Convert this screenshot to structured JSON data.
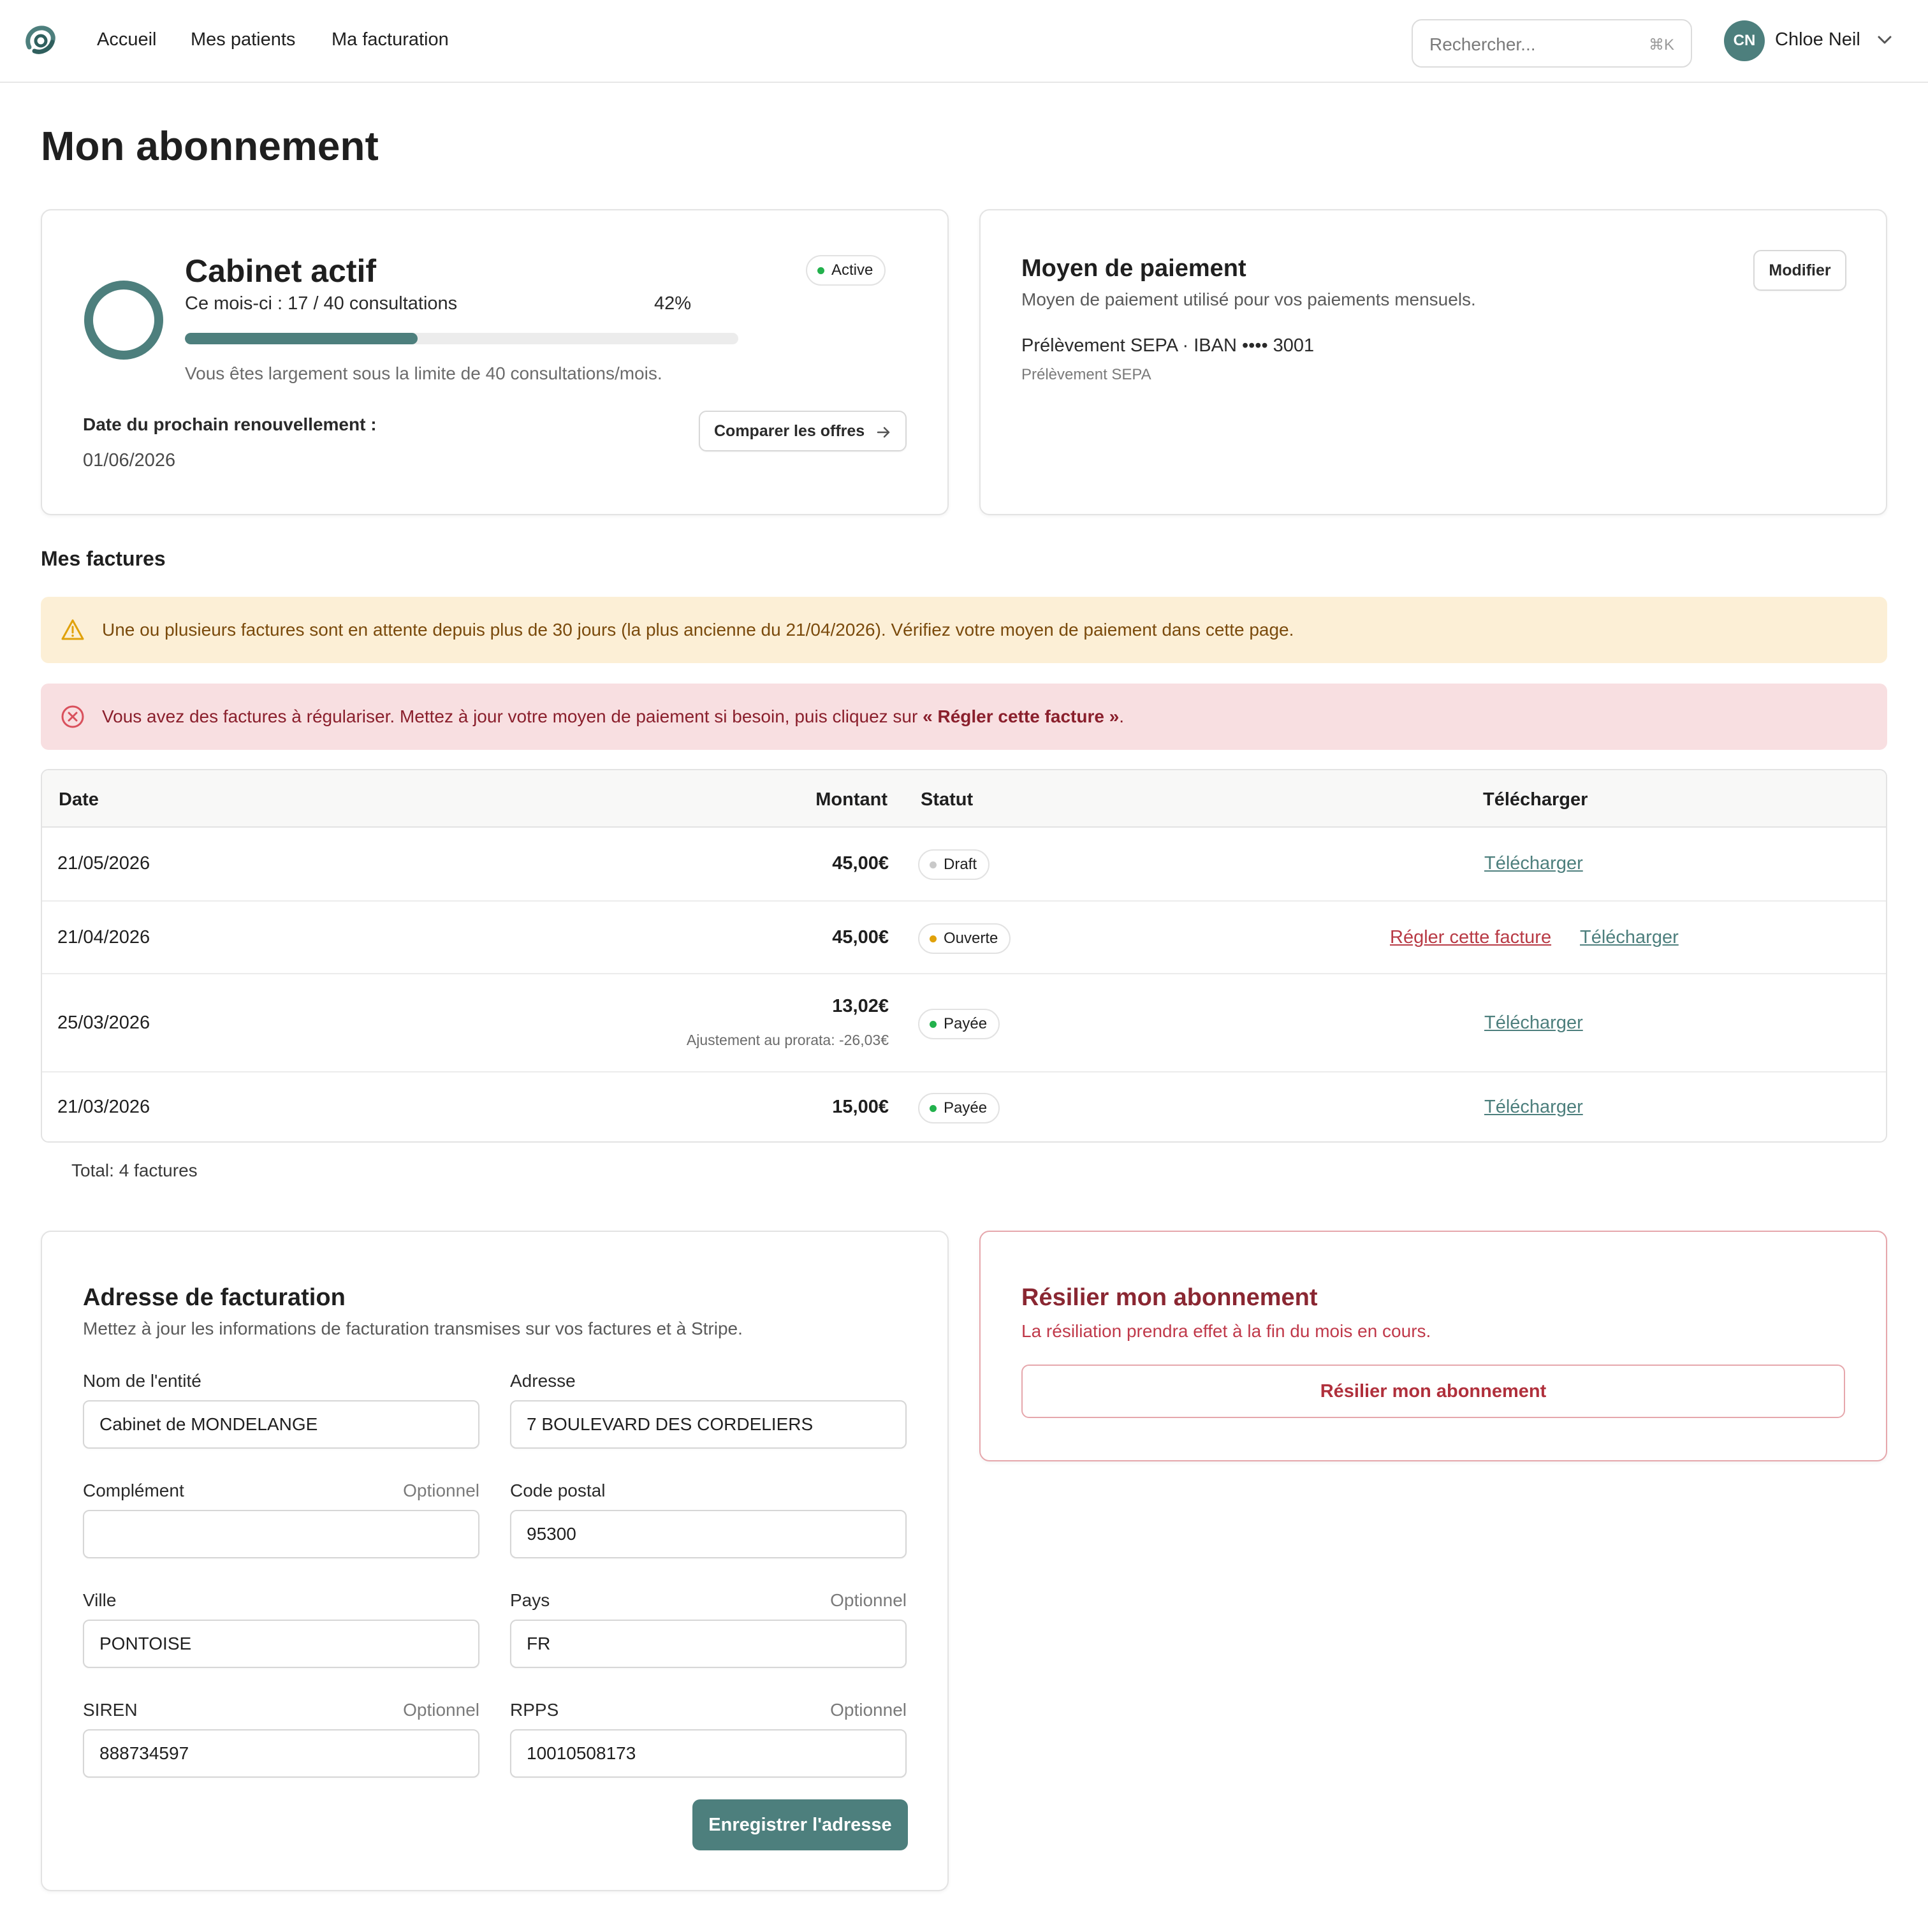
{
  "header": {
    "nav": [
      "Accueil",
      "Mes patients",
      "Ma facturation"
    ],
    "search": {
      "placeholder": "Rechercher...",
      "shortcut": "⌘K"
    },
    "user": {
      "initials": "CN",
      "name": "Chloe Neil"
    }
  },
  "page": {
    "title": "Mon abonnement"
  },
  "subscription": {
    "plan": "Cabinet actif",
    "status": "Active",
    "usage_text": "Ce mois-ci : 17 / 40 consultations",
    "usage_percent_label": "42%",
    "usage_fraction": 0.42,
    "usage_note": "Vous êtes largement sous la limite de 40 consultations/mois.",
    "renewal_label": "Date du prochain renouvellement :",
    "renewal_date": "01/06/2026",
    "compare_button": "Comparer les offres"
  },
  "payment": {
    "title": "Moyen de paiement",
    "subtitle": "Moyen de paiement utilisé pour vos paiements mensuels.",
    "method": "Prélèvement SEPA · IBAN •••• 3001",
    "method_type": "Prélèvement SEPA",
    "edit_button": "Modifier"
  },
  "invoices": {
    "title": "Mes factures",
    "warning": "Une ou plusieurs factures sont en attente depuis plus de 30 jours (la plus ancienne du 21/04/2026). Vérifiez votre moyen de paiement dans cette page.",
    "error_prefix": "Vous avez des factures à régulariser. Mettez à jour votre moyen de paiement si besoin, puis cliquez sur ",
    "error_emphasis": "« Régler cette facture »",
    "error_suffix": ".",
    "columns": {
      "date": "Date",
      "amount": "Montant",
      "status": "Statut",
      "download": "Télécharger"
    },
    "rows": [
      {
        "date": "21/05/2026",
        "amount": "45,00€",
        "status": "Draft",
        "download": "Télécharger"
      },
      {
        "date": "21/04/2026",
        "amount": "45,00€",
        "status": "Ouverte",
        "pay": "Régler cette facture",
        "download": "Télécharger"
      },
      {
        "date": "25/03/2026",
        "amount": "13,02€",
        "note": "Ajustement au prorata: -26,03€",
        "status": "Payée",
        "download": "Télécharger"
      },
      {
        "date": "21/03/2026",
        "amount": "15,00€",
        "status": "Payée",
        "download": "Télécharger"
      }
    ],
    "total": "Total: 4 factures"
  },
  "address": {
    "title": "Adresse de facturation",
    "subtitle": "Mettez à jour les informations de facturation transmises sur vos factures et à Stripe.",
    "optional_label": "Optionnel",
    "fields": {
      "entity": {
        "label": "Nom de l'entité",
        "value": "Cabinet de MONDELANGE"
      },
      "address": {
        "label": "Adresse",
        "value": "7 BOULEVARD DES CORDELIERS"
      },
      "complement": {
        "label": "Complément",
        "value": ""
      },
      "postal": {
        "label": "Code postal",
        "value": "95300"
      },
      "city": {
        "label": "Ville",
        "value": "PONTOISE"
      },
      "country": {
        "label": "Pays",
        "value": "FR"
      },
      "siren": {
        "label": "SIREN",
        "value": "888734597"
      },
      "rpps": {
        "label": "RPPS",
        "value": "10010508173"
      }
    },
    "save_button": "Enregistrer l'adresse"
  },
  "cancel": {
    "title": "Résilier mon abonnement",
    "subtitle": "La résiliation prendra effet à la fin du mois en cours.",
    "button": "Résilier mon abonnement"
  },
  "colors": {
    "accent": "#4d7f7d",
    "active": "#22b14c",
    "open": "#e0a10a",
    "draft": "#c9c9c9",
    "danger": "#b0303c"
  }
}
